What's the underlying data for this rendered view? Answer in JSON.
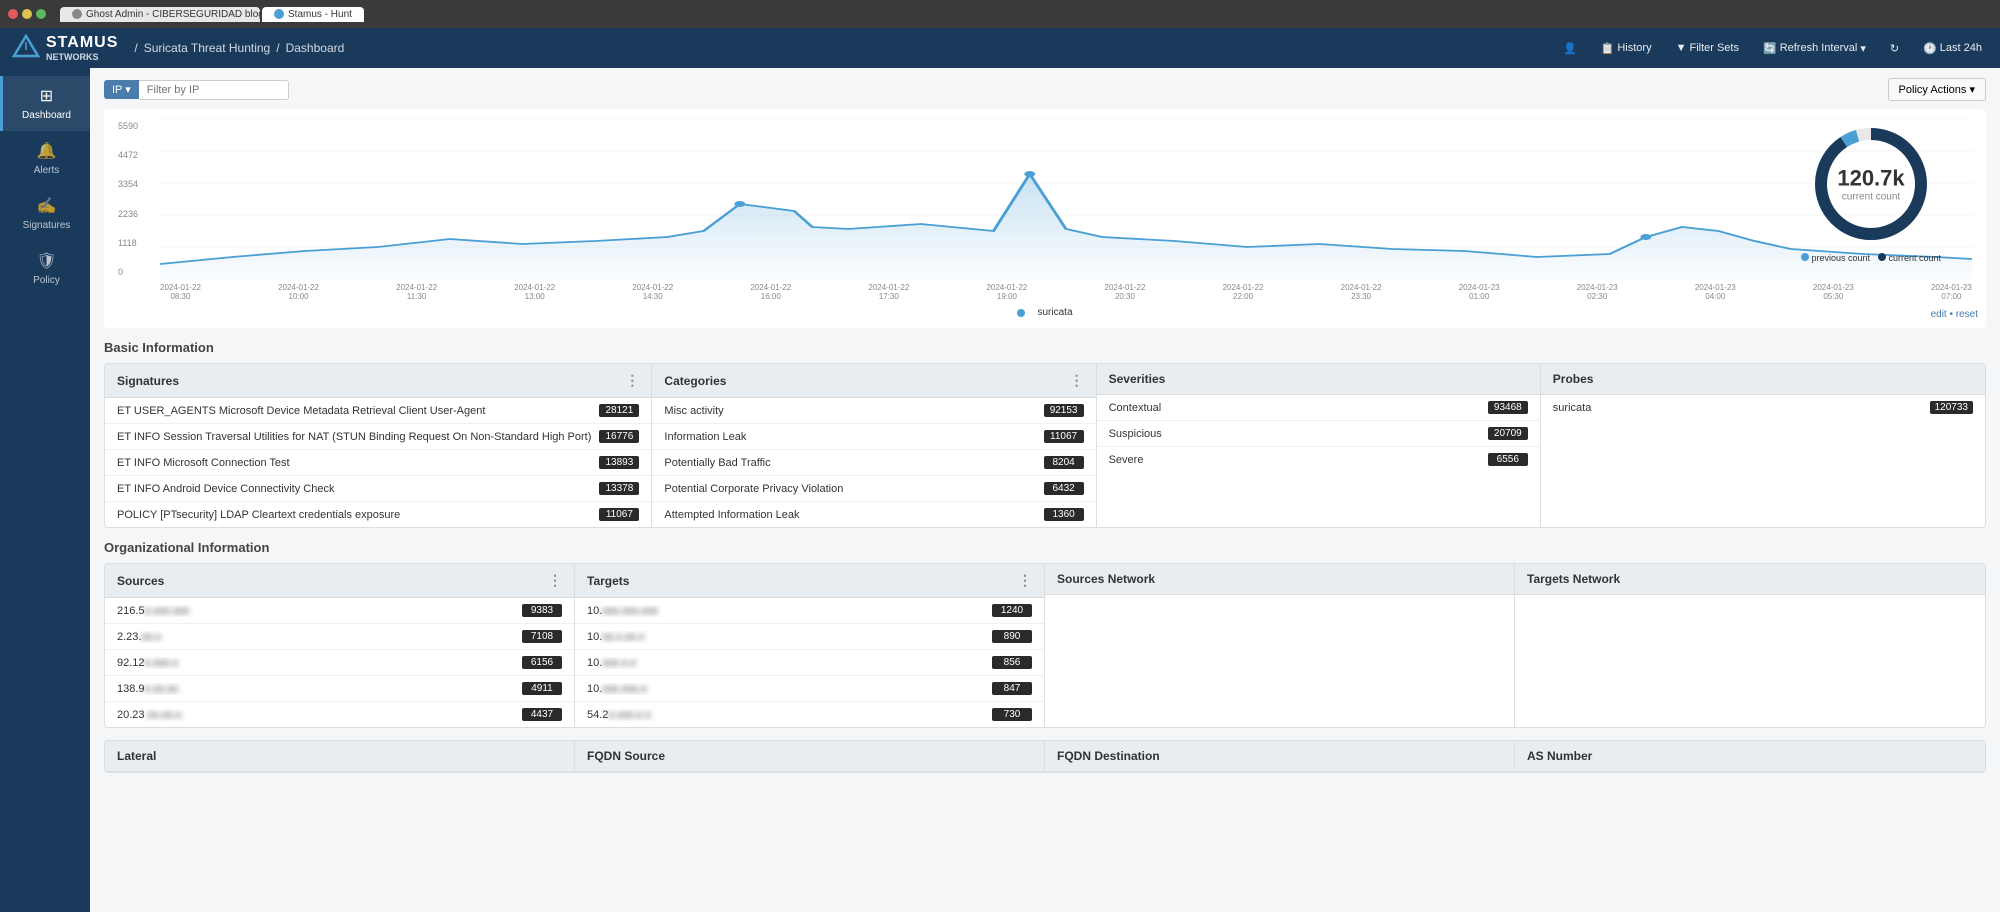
{
  "browser": {
    "tabs": [
      {
        "label": "Ghost Admin - CIBERSEGURIDAD blog",
        "active": false,
        "iconColor": "#888"
      },
      {
        "label": "Stamus - Hunt",
        "active": true,
        "iconColor": "#4a9fd4"
      },
      {
        "label": "",
        "active": false,
        "iconColor": "#888"
      }
    ]
  },
  "nav": {
    "logo": "STAMUS",
    "logo_sub": "NETWORKS",
    "breadcrumb_home": "Suricata Threat Hunting",
    "breadcrumb_sep": "/",
    "breadcrumb_current": "Dashboard",
    "history": "History",
    "filter_sets": "Filter Sets",
    "refresh_interval": "Refresh Interval",
    "last_24h": "Last 24h",
    "user_icon": "👤"
  },
  "sidebar": {
    "items": [
      {
        "label": "Dashboard",
        "icon": "⊞",
        "active": true
      },
      {
        "label": "Alerts",
        "icon": "🔔",
        "active": false
      },
      {
        "label": "Signatures",
        "icon": "✍",
        "active": false
      },
      {
        "label": "Policy",
        "icon": "🛡",
        "active": false
      }
    ]
  },
  "toolbar": {
    "ip_label": "IP ▾",
    "ip_placeholder": "Filter by IP",
    "policy_actions": "Policy Actions ▾"
  },
  "chart": {
    "y_labels": [
      "5590",
      "4472",
      "3354",
      "2236",
      "1118",
      "0"
    ],
    "x_labels": [
      "2024-01-22\n08:30",
      "2024-01-22\n10:00",
      "2024-01-22\n11:30",
      "2024-01-22\n13:00",
      "2024-01-22\n14:30",
      "2024-01-22\n16:00",
      "2024-01-22\n17:30",
      "2024-01-22\n19:00",
      "2024-01-22\n20:30",
      "2024-01-22\n22:00",
      "2024-01-22\n23:30",
      "2024-01-23\n01:00",
      "2024-01-23\n02:30",
      "2024-01-23\n04:00",
      "2024-01-23\n05:30",
      "2024-01-23\n07:00"
    ],
    "legend_suricata": "suricata",
    "legend_previous": "previous count",
    "legend_current": "current count",
    "donut_value": "120.7k",
    "donut_sub": "current count",
    "edit_reset": "edit • reset",
    "previous_count_color": "#4a9fd4",
    "current_count_color": "#1a3a5c"
  },
  "basic_info": {
    "title": "Basic Information",
    "sections": {
      "signatures": {
        "header": "Signatures",
        "rows": [
          {
            "label": "ET USER_AGENTS Microsoft Device Metadata Retrieval Client User-Agent",
            "value": "28121"
          },
          {
            "label": "ET INFO Session Traversal Utilities for NAT (STUN Binding Request On Non-Standard High Port)",
            "value": "16776"
          },
          {
            "label": "ET INFO Microsoft Connection Test",
            "value": "13893"
          },
          {
            "label": "ET INFO Android Device Connectivity Check",
            "value": "13378"
          },
          {
            "label": "POLICY [PTsecurity] LDAP Cleartext credentials exposure",
            "value": "11067"
          }
        ]
      },
      "categories": {
        "header": "Categories",
        "rows": [
          {
            "label": "Misc activity",
            "value": "92153"
          },
          {
            "label": "Information Leak",
            "value": "11067"
          },
          {
            "label": "Potentially Bad Traffic",
            "value": "8204"
          },
          {
            "label": "Potential Corporate Privacy Violation",
            "value": "6432"
          },
          {
            "label": "Attempted Information Leak",
            "value": "1360"
          }
        ]
      },
      "severities": {
        "header": "Severities",
        "rows": [
          {
            "label": "Contextual",
            "value": "93468"
          },
          {
            "label": "Suspicious",
            "value": "20709"
          },
          {
            "label": "Severe",
            "value": "6556"
          }
        ]
      },
      "probes": {
        "header": "Probes",
        "rows": [
          {
            "label": "suricata",
            "value": "120733"
          }
        ]
      }
    }
  },
  "org_info": {
    "title": "Organizational Information",
    "sections": {
      "sources": {
        "header": "Sources",
        "rows": [
          {
            "label": "216.5x.xxx.xxx",
            "blurred": true,
            "value": "9383"
          },
          {
            "label": "2.23.xx.x",
            "blurred": true,
            "value": "7108"
          },
          {
            "label": "92.12x.xxx.x",
            "blurred": true,
            "value": "6156"
          },
          {
            "label": "138.9x.xx.xx",
            "blurred": true,
            "value": "4911"
          },
          {
            "label": "20.23.xx.xx.x",
            "blurred": true,
            "value": "4437"
          }
        ]
      },
      "targets": {
        "header": "Targets",
        "rows": [
          {
            "label": "10.xxx.xxx.xxx",
            "blurred": true,
            "value": "1240"
          },
          {
            "label": "10.xx.x.xx.x",
            "blurred": true,
            "value": "890"
          },
          {
            "label": "10.xxx.x.x",
            "blurred": true,
            "value": "856"
          },
          {
            "label": "10.xxx.xxx.x",
            "blurred": true,
            "value": "847"
          },
          {
            "label": "54.2x.xxx.x.x",
            "blurred": true,
            "value": "730"
          }
        ]
      },
      "sources_network": {
        "header": "Sources Network",
        "rows": []
      },
      "targets_network": {
        "header": "Targets Network",
        "rows": []
      }
    }
  },
  "bottom_sections": {
    "lateral": "Lateral",
    "fqdn_source": "FQDN Source",
    "fqdn_dest": "FQDN Destination",
    "as_number": "AS Number"
  }
}
